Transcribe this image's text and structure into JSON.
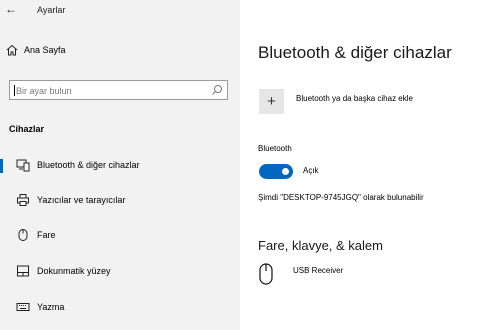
{
  "window": {
    "title": "Ayarlar"
  },
  "sidebar": {
    "home_label": "Ana Sayfa",
    "search_placeholder": "Bir ayar bulun",
    "section_label": "Cihazlar",
    "items": [
      {
        "label": "Bluetooth & diğer cihazlar",
        "icon": "bluetooth-devices-icon",
        "selected": true
      },
      {
        "label": "Yazıcılar ve tarayıcılar",
        "icon": "printer-icon",
        "selected": false
      },
      {
        "label": "Fare",
        "icon": "mouse-icon",
        "selected": false
      },
      {
        "label": "Dokunmatik yüzey",
        "icon": "touchpad-icon",
        "selected": false
      },
      {
        "label": "Yazma",
        "icon": "keyboard-icon",
        "selected": false
      }
    ]
  },
  "main": {
    "title": "Bluetooth & diğer cihazlar",
    "add_device_label": "Bluetooth ya da başka cihaz ekle",
    "bluetooth_label": "Bluetooth",
    "toggle_state": "Açık",
    "discoverable_text": "Şimdi \"DESKTOP-9745JGQ\" olarak bulunabilir",
    "section_title": "Fare, klavye, & kalem",
    "devices": [
      {
        "name": "USB Receiver",
        "icon": "mouse-icon"
      }
    ]
  },
  "colors": {
    "accent": "#0067c0",
    "sidebar_bg": "#f2f2f2"
  }
}
